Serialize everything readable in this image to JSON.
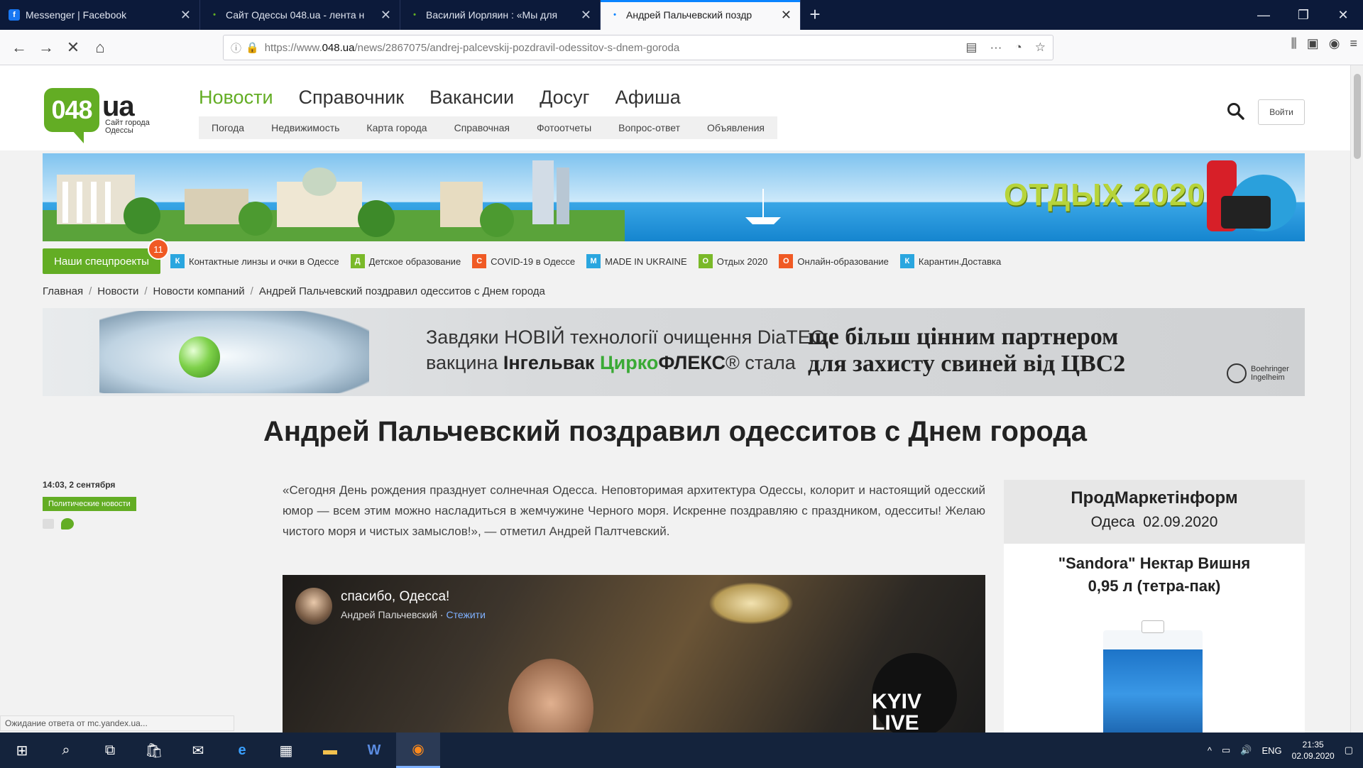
{
  "browser": {
    "tabs": [
      {
        "title": "Messenger | Facebook",
        "icon": "facebook-icon",
        "color": "#1877f2"
      },
      {
        "title": "Сайт Одессы 048.ua - лента н",
        "icon": "dot-icon",
        "color": "#63ad24"
      },
      {
        "title": "Василий Иорляин : «Мы для",
        "icon": "dot-icon",
        "color": "#63ad24"
      },
      {
        "title": "Андрей Пальчевский поздр",
        "icon": "dot-icon",
        "color": "#0a84ff"
      }
    ],
    "url_prefix": "https://www.",
    "url_domain": "048.ua",
    "url_path": "/news/2867075/andrej-palcevskij-pozdravil-odessitov-s-dnem-goroda",
    "status_text": "Ожидание ответа от mc.yandex.ua..."
  },
  "site": {
    "logo_number": "048",
    "logo_ua": "ua",
    "logo_subtitle": "Сайт города Одессы",
    "main_nav": [
      "Новости",
      "Справочник",
      "Вакансии",
      "Досуг",
      "Афиша"
    ],
    "sub_nav": [
      "Погода",
      "Недвижимость",
      "Карта города",
      "Справочная",
      "Фотоотчеты",
      "Вопрос-ответ",
      "Объявления"
    ],
    "login_label": "Войти",
    "banner_text": "ОТДЫХ 2020",
    "spec_button": "Наши спецпроекты",
    "spec_badge": "11",
    "spec_items": [
      {
        "letter": "К",
        "color": "#2aa6df",
        "label": "Контактные линзы и очки в Одессе"
      },
      {
        "letter": "Д",
        "color": "#7ab929",
        "label": "Детское образование"
      },
      {
        "letter": "С",
        "color": "#f05a24",
        "label": "COVID-19 в Одессе"
      },
      {
        "letter": "М",
        "color": "#2aa6df",
        "label": "MADE IN UKRAINE"
      },
      {
        "letter": "О",
        "color": "#7ab929",
        "label": "Отдых 2020"
      },
      {
        "letter": "О",
        "color": "#f05a24",
        "label": "Онлайн-образование"
      },
      {
        "letter": "К",
        "color": "#2aa6df",
        "label": "Карантин.Доставка"
      }
    ],
    "breadcrumbs": [
      "Главная",
      "Новости",
      "Новости компаний",
      "Андрей Пальчевский поздравил одесситов с Днем города"
    ]
  },
  "ad": {
    "line1": "Завдяки НОВІЙ технології очищення DiaTEC,",
    "line2_a": "вакцина ",
    "line2_b": "Інгельвак",
    "line2_c": " Цирко",
    "line2_d": "ФЛЕКС",
    "line2_e": "® стала",
    "right1": "ще більш цінним партнером",
    "right2": "для захисту свиней від ЦВС2",
    "brand": "Boehringer Ingelheim"
  },
  "article": {
    "title": "Андрей Пальчевский поздравил одесситов с Днем города",
    "date": "14:03, 2 сентября",
    "category": "Политические новости",
    "lead": "«Сегодня День рождения празднует солнечная Одесса. Неповторимая архитектура Одессы, колорит и настоящий одесский юмор — всем этим можно насладиться в жемчужине Черного моря. Искренне поздравляю с праздником, одесситы! Желаю чистого моря и чистых замыслов!», — отметил Андрей Палтчевский.",
    "video_title": "спасибо, Одесса!",
    "video_author": "Андрей Пальчевский",
    "video_action": "Стежити",
    "video_badge": "KYIV LIVE"
  },
  "sidebar": {
    "name": "ПродМаркетінформ",
    "city": "Одеса",
    "date": "02.09.2020",
    "product_line1": "\"Sandora\" Нектар Вишня",
    "product_line2": "0,95 л (тетра-пак)"
  },
  "taskbar": {
    "lang": "ENG",
    "time": "21:35",
    "date": "02.09.2020"
  }
}
